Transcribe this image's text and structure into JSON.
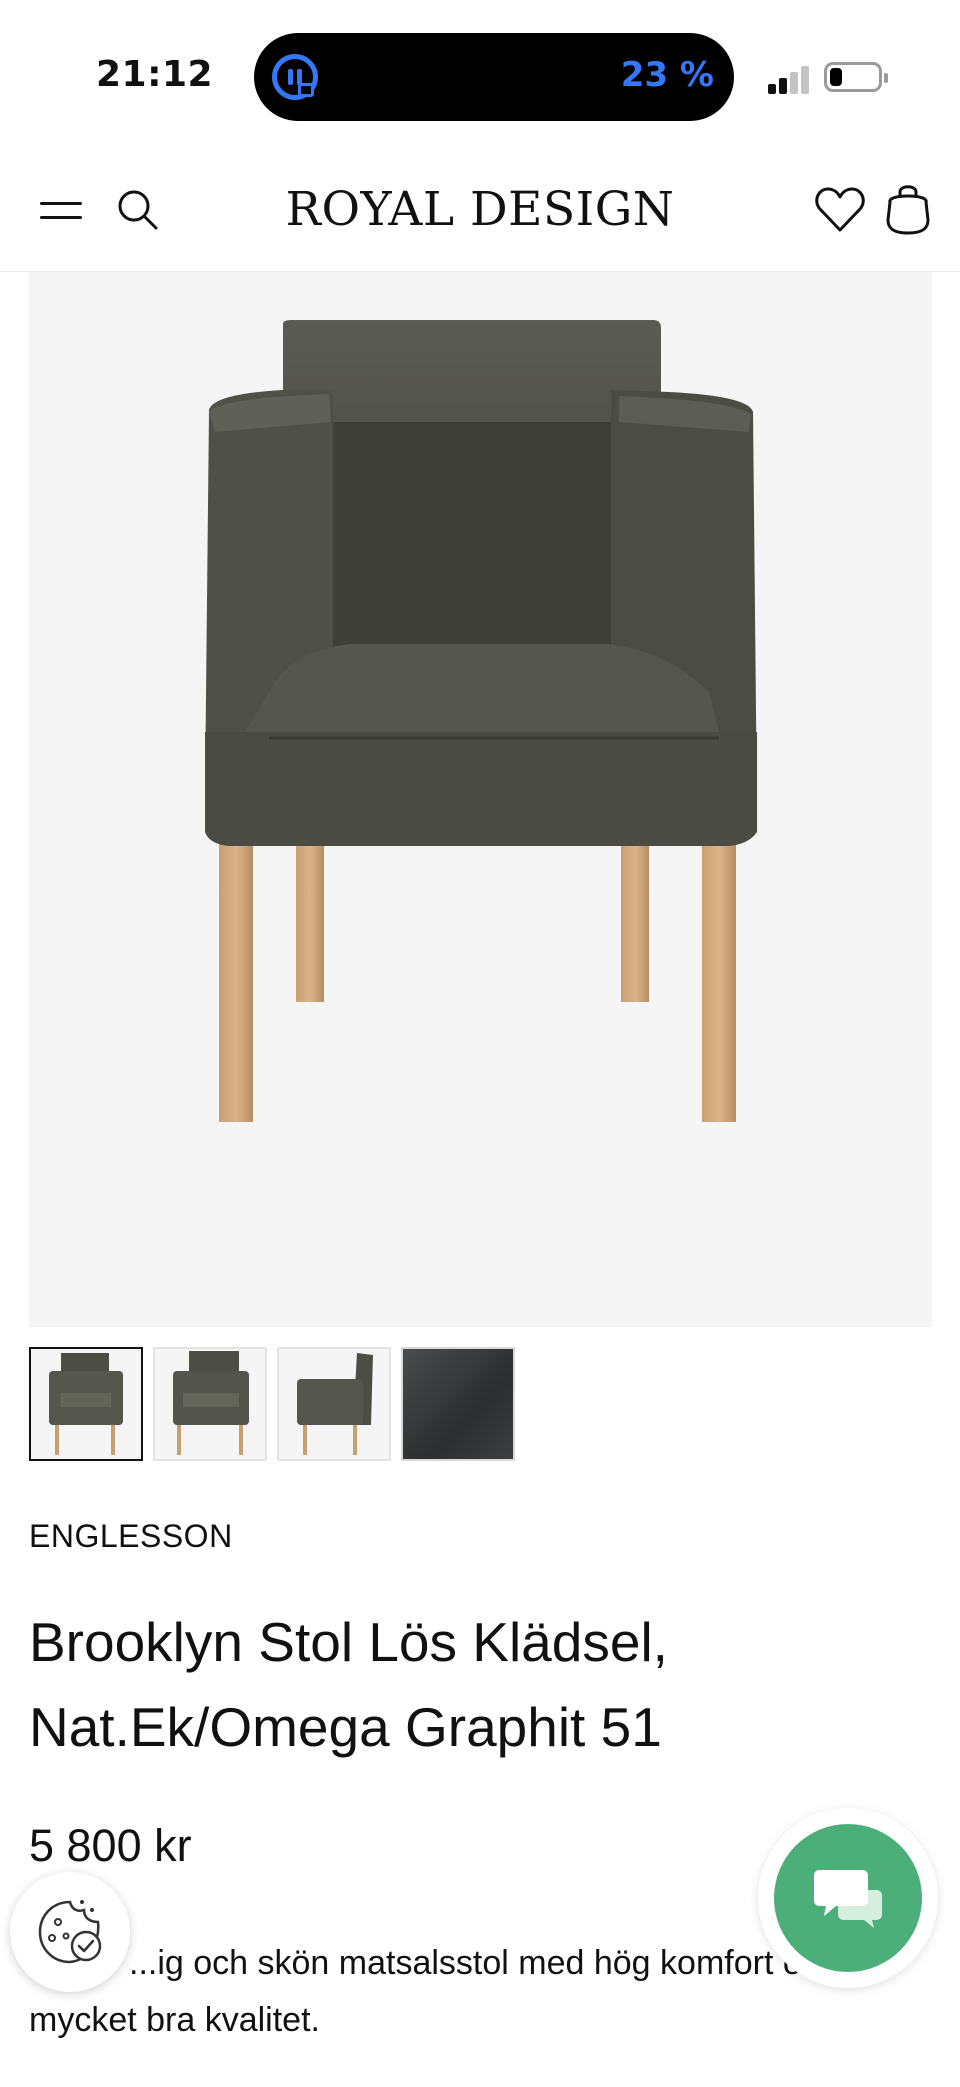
{
  "status_bar": {
    "time": "21:12",
    "battery_percent_label": "23 %",
    "battery_level": 0.23,
    "accent_color": "#3478f6"
  },
  "header": {
    "brand": "ROYAL DESIGN",
    "icons": [
      "menu-icon",
      "search-icon",
      "heart-icon",
      "bag-icon"
    ]
  },
  "product": {
    "brand_name": "ENGLESSON",
    "title": "Brooklyn Stol Lös Klädsel, Nat.Ek/Omega Graphit 51",
    "price": "5 800 kr",
    "description": "Snygg och skön matsalsstol med hög komfort och mycket bra kvalitet.",
    "description_visible_line1": "...ig och skön matsalsstol med hög komfort o",
    "description_visible_line2": "mycket bra kvalitet.",
    "thumbnails": [
      "front",
      "angle",
      "side",
      "fabric-swatch"
    ],
    "selected_thumbnail": 0
  },
  "floating": {
    "cookie_icon": "cookie-icon",
    "chat_icon": "chat-icon",
    "chat_color": "#4caf7a"
  }
}
